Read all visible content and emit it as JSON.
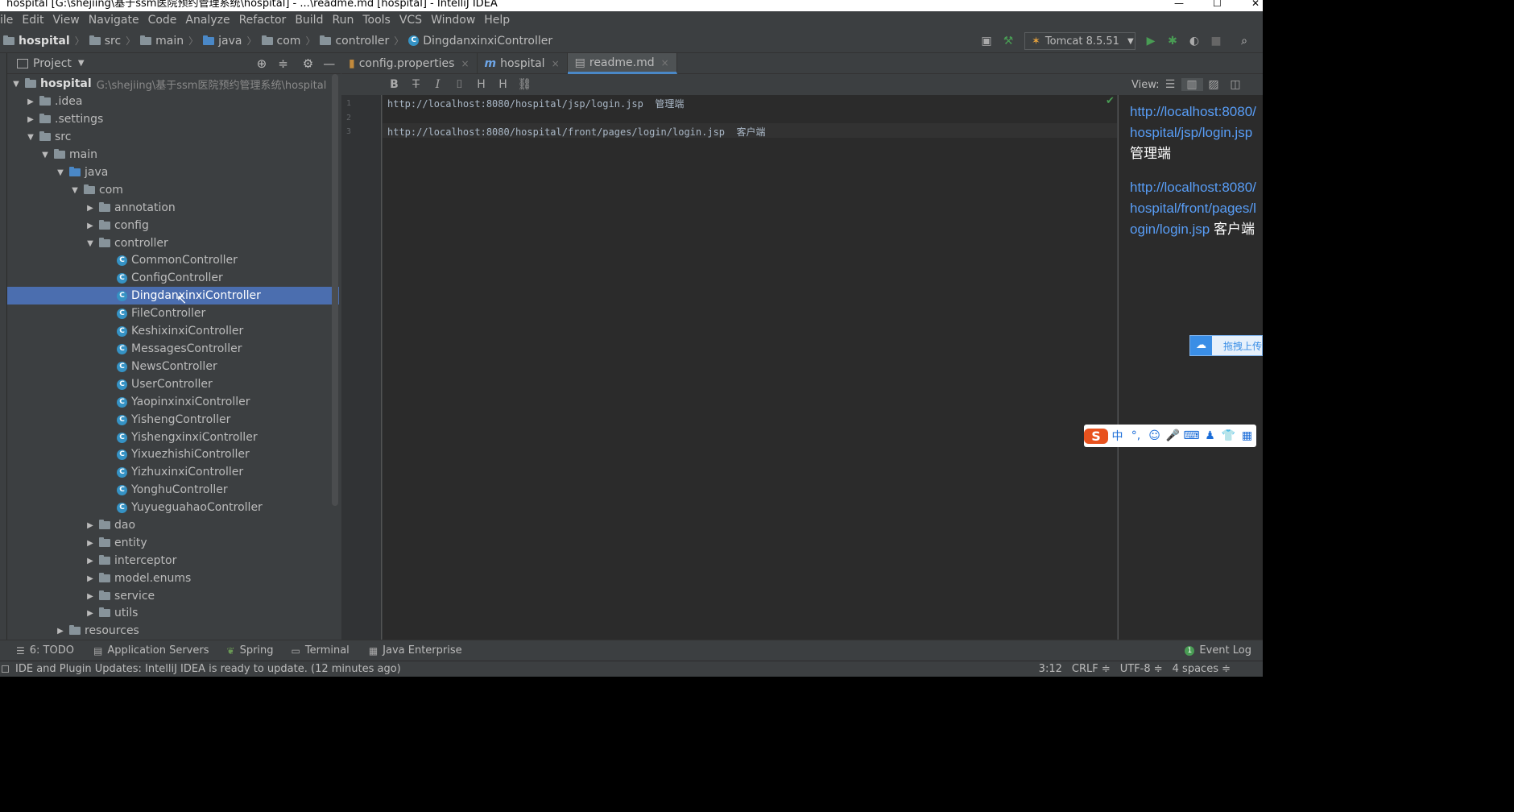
{
  "window": {
    "title": "hospital [G:\\shejiing\\基于ssm医院预约管理系统\\hospital] - ...\\readme.md [hospital] - IntelliJ IDEA",
    "min": "—",
    "max": "☐",
    "close": "✕"
  },
  "menu": [
    "ile",
    "Edit",
    "View",
    "Navigate",
    "Code",
    "Analyze",
    "Refactor",
    "Build",
    "Run",
    "Tools",
    "VCS",
    "Window",
    "Help"
  ],
  "breadcrumb": [
    "hospital",
    "src",
    "main",
    "java",
    "com",
    "controller",
    "DingdanxinxiController"
  ],
  "run_config": {
    "label": "Tomcat 8.5.51",
    "arrow": "▼"
  },
  "project_panel": {
    "title": "Project",
    "dropdown": "▼",
    "root_name": "hospital",
    "root_path": "G:\\shejiing\\基于ssm医院预约管理系统\\hospital",
    "nodes": [
      {
        "label": ".idea",
        "arrow": "▶"
      },
      {
        "label": ".settings",
        "arrow": "▶"
      },
      {
        "label": "src",
        "arrow": "▼"
      },
      {
        "label": "main",
        "arrow": "▼"
      },
      {
        "label": "java",
        "arrow": "▼"
      },
      {
        "label": "com",
        "arrow": "▼"
      },
      {
        "label": "annotation",
        "arrow": "▶"
      },
      {
        "label": "config",
        "arrow": "▶"
      },
      {
        "label": "controller",
        "arrow": "▼"
      },
      {
        "label": "dao",
        "arrow": "▶"
      },
      {
        "label": "entity",
        "arrow": "▶"
      },
      {
        "label": "interceptor",
        "arrow": "▶"
      },
      {
        "label": "model.enums",
        "arrow": "▶"
      },
      {
        "label": "service",
        "arrow": "▶"
      },
      {
        "label": "utils",
        "arrow": "▶"
      },
      {
        "label": "resources",
        "arrow": "▶"
      }
    ],
    "classes": [
      "CommonController",
      "ConfigController",
      "DingdanxinxiController",
      "FileController",
      "KeshixinxiController",
      "MessagesController",
      "NewsController",
      "UserController",
      "YaopinxinxiController",
      "YishengController",
      "YishengxinxiController",
      "YixuezhishiController",
      "YizhuxinxiController",
      "YonghuController",
      "YuyueguahaoController"
    ],
    "selected_class": "DingdanxinxiController"
  },
  "tabs": [
    {
      "label": "config.properties",
      "close": "×"
    },
    {
      "label": "hospital",
      "close": "×"
    },
    {
      "label": "readme.md",
      "close": "×"
    }
  ],
  "md_toolbar": {
    "view_label": "View:"
  },
  "editor": {
    "line_numbers": [
      "1",
      "2",
      "3"
    ],
    "lines": [
      "http://localhost:8080/hospital/jsp/login.jsp  管理端",
      "",
      "http://localhost:8080/hospital/front/pages/login/login.jsp  客户端"
    ]
  },
  "preview": {
    "p1_link": "http://localhost:8080/hospital/jsp/login.jsp",
    "p1_text": " 管理端",
    "p2_link": "http://localhost:8080/hospital/front/pages/login/login.jsp",
    "p2_text": " 客户端"
  },
  "tool_windows": [
    "6: TODO",
    "Application Servers",
    "Spring",
    "Terminal",
    "Java Enterprise"
  ],
  "event_log": {
    "count": "1",
    "label": "Event Log"
  },
  "status": {
    "message": "IDE and Plugin Updates: IntelliJ IDEA is ready to update. (12 minutes ago)",
    "position": "3:12",
    "line_sep": "CRLF ≑",
    "encoding": "UTF-8 ≑",
    "indent": "4 spaces ≑"
  },
  "overlays": {
    "baidu_label": "拖拽上传",
    "ime_lang": "中"
  },
  "colors": {
    "accent": "#4a88c7",
    "selection": "#4b6eaf",
    "link": "#589df6",
    "run_green": "#499c54"
  }
}
